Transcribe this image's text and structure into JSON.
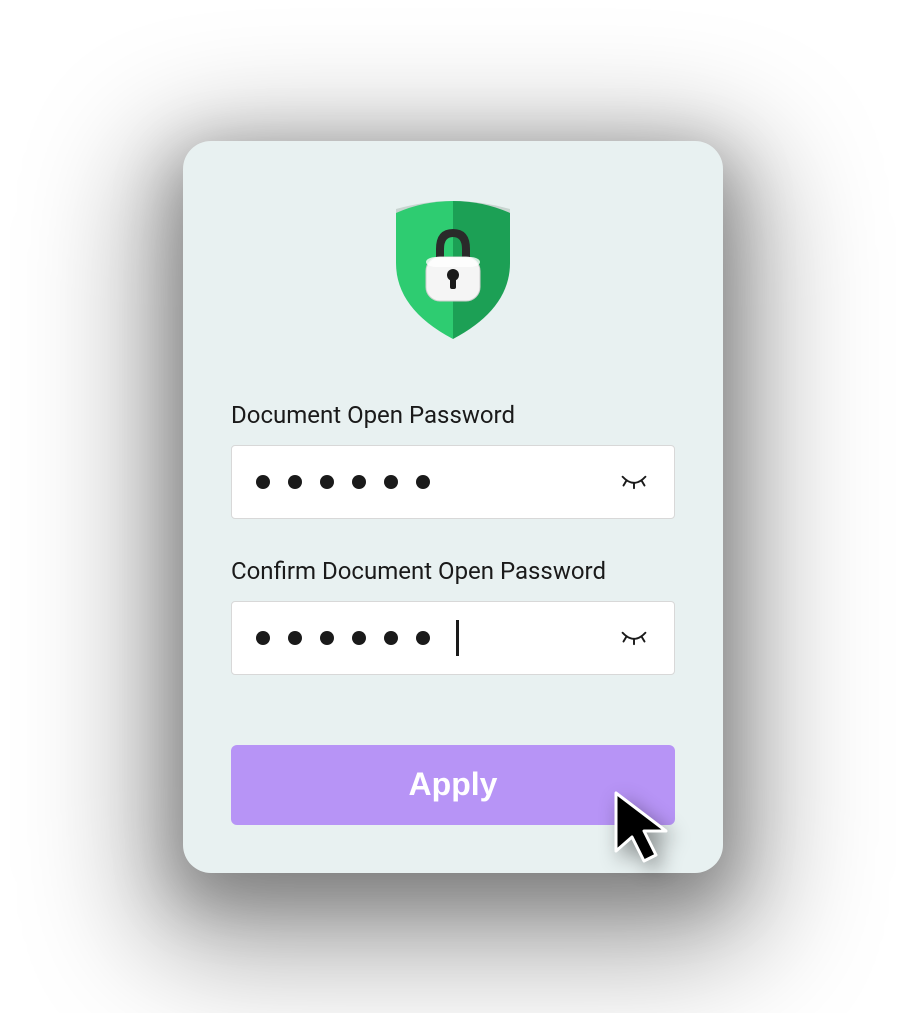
{
  "dialog": {
    "icon": "shield-lock-icon",
    "passwordField": {
      "label": "Document Open Password",
      "maskedLength": 6,
      "showPassword": false
    },
    "confirmField": {
      "label": "Confirm Document Open Password",
      "maskedLength": 6,
      "showPassword": false,
      "hasFocus": true
    },
    "applyButton": {
      "label": "Apply"
    }
  },
  "colors": {
    "panelBackground": "#e8f1f1",
    "inputBackground": "#ffffff",
    "buttonBackground": "#b794f6",
    "buttonText": "#ffffff",
    "shieldGreen": "#2ecc71",
    "text": "#1a1a1a"
  }
}
